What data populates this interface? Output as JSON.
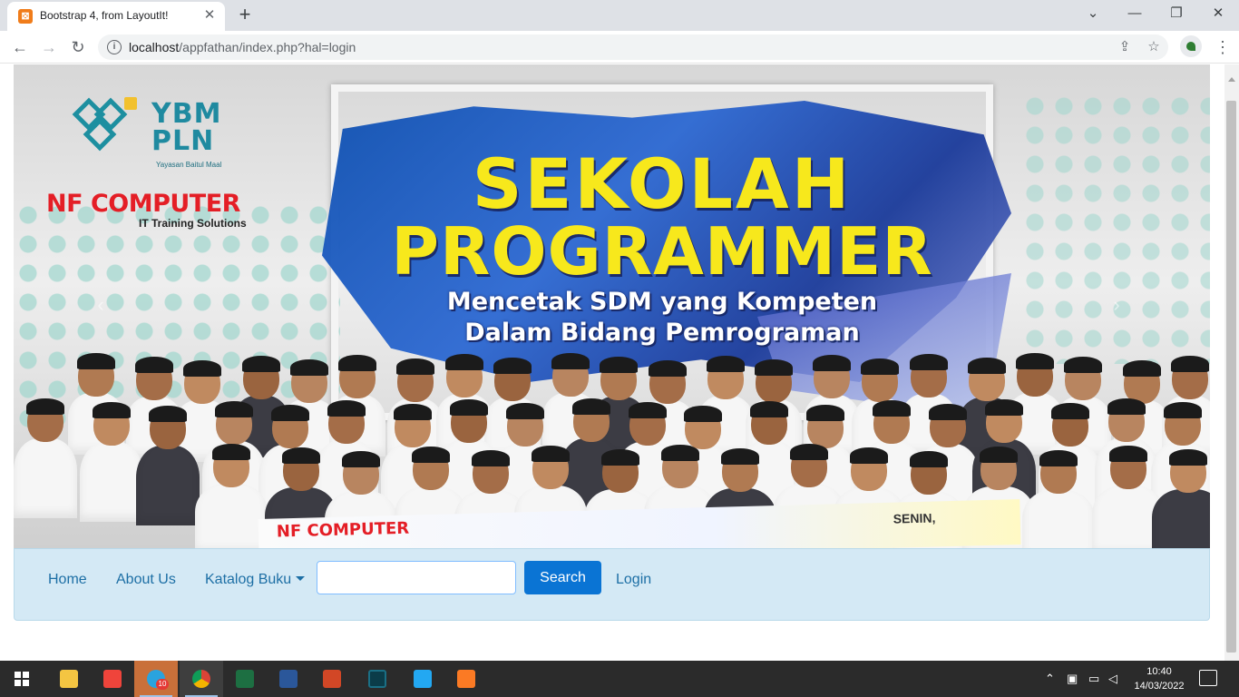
{
  "browser": {
    "tab_title": "Bootstrap 4, from LayoutIt!",
    "tab_favicon": "layoutit-favicon",
    "url_host": "localhost",
    "url_path": "/appfathan/index.php?hal=login"
  },
  "banner": {
    "org_name_line1": "YBM",
    "org_name_line2": "PLN",
    "org_subtitle": "Yayasan Baitul Maal",
    "partner_name": "NF COMPUTER",
    "partner_tagline": "IT Training Solutions",
    "headline_1": "SEKOLAH",
    "headline_2": "PROGRAMMER",
    "tagline_1": "Mencetak SDM yang Kompeten",
    "tagline_2": "Dalam Bidang Pemrograman",
    "photo_banner_text": "NF COMPUTER",
    "photo_banner_date": "SENIN,"
  },
  "navbar": {
    "home": "Home",
    "about": "About Us",
    "catalog": "Katalog Buku",
    "search_value": "",
    "search_button": "Search",
    "login": "Login"
  },
  "taskbar": {
    "apps": [
      "start-icon",
      "file-explorer-icon",
      "anydesk-icon",
      "telegram-icon",
      "chrome-icon",
      "excel-icon",
      "word-icon",
      "powerpoint-icon",
      "terminal-icon",
      "vscode-icon",
      "xampp-icon"
    ],
    "telegram_badge": "10",
    "time": "10:40",
    "date": "14/03/2022"
  },
  "colors": {
    "navbar_bg": "#d4e9f5",
    "link": "#1d6fa5",
    "button": "#0a74d4",
    "headline": "#f7e81c"
  }
}
